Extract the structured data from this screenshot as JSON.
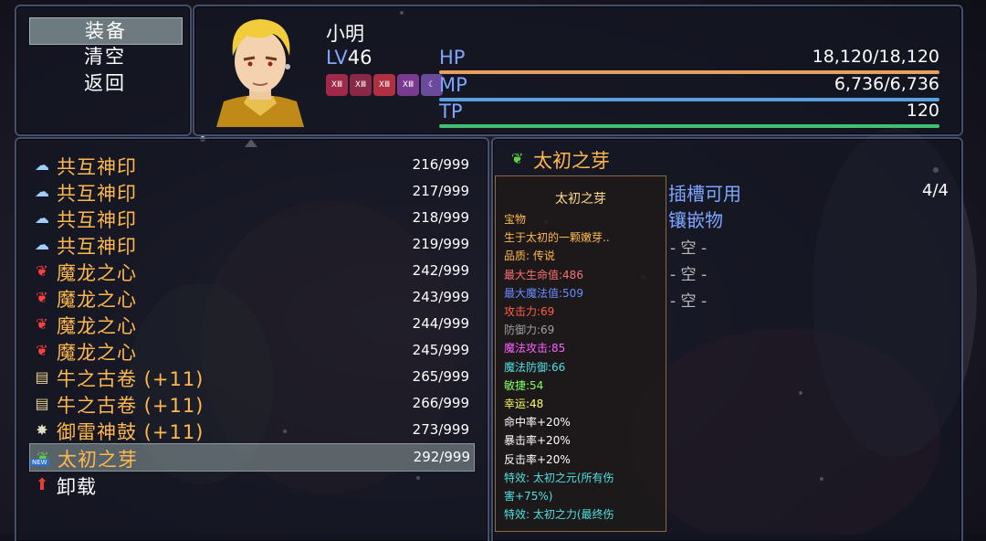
{
  "menu": {
    "commands": [
      {
        "label": "装备"
      },
      {
        "label": "清空"
      },
      {
        "label": "返回"
      }
    ]
  },
  "actor": {
    "name": "小明",
    "level_label": "LV",
    "level": "46",
    "state_icons": [
      "icon-1",
      "icon-2",
      "icon-3",
      "icon-4",
      "icon-5"
    ],
    "stats": [
      {
        "label": "HP",
        "value": "18,120/18,120",
        "fill": 1.0,
        "color": "#e8a060"
      },
      {
        "label": "MP",
        "value": "6,736/6,736",
        "fill": 1.0,
        "color": "#5aa0e0"
      },
      {
        "label": "TP",
        "value": "120",
        "fill": 1.0,
        "color": "#40c070"
      }
    ]
  },
  "items": [
    {
      "icon": "seal-icon",
      "name": "共互神印",
      "count": "216/999"
    },
    {
      "icon": "seal-icon",
      "name": "共互神印",
      "count": "217/999"
    },
    {
      "icon": "seal-icon",
      "name": "共互神印",
      "count": "218/999"
    },
    {
      "icon": "seal-icon",
      "name": "共互神印",
      "count": "219/999"
    },
    {
      "icon": "dragon-heart-icon",
      "name": "魔龙之心",
      "count": "242/999"
    },
    {
      "icon": "dragon-heart-icon",
      "name": "魔龙之心",
      "count": "243/999"
    },
    {
      "icon": "dragon-heart-icon",
      "name": "魔龙之心",
      "count": "244/999"
    },
    {
      "icon": "dragon-heart-icon",
      "name": "魔龙之心",
      "count": "245/999"
    },
    {
      "icon": "scroll-icon",
      "name": "牛之古卷 (+11)",
      "count": "265/999"
    },
    {
      "icon": "scroll-icon",
      "name": "牛之古卷 (+11)",
      "count": "266/999"
    },
    {
      "icon": "drum-icon",
      "name": "御雷神鼓 (+11)",
      "count": "273/999"
    },
    {
      "icon": "sprout-icon",
      "name": "太初之芽",
      "count": "292/999",
      "badge": "NEW",
      "selected": true
    }
  ],
  "unequip": {
    "icon": "arrow-up-icon",
    "label": "卸载"
  },
  "detail": {
    "title": "太初之芽",
    "tooltip": [
      {
        "text": "太初之芽",
        "color": "#ffd98a"
      },
      {
        "text": "宝物",
        "color": "#ffb84d"
      },
      {
        "text": "生于太初的一颗嫩芽..",
        "color": "#ffb84d"
      },
      {
        "text": "品质: 传说",
        "color": "#ffb84d"
      },
      {
        "text": "最大生命值:486",
        "color": "#ff7070"
      },
      {
        "text": "最大魔法值:509",
        "color": "#6a8cff"
      },
      {
        "text": "攻击力:69",
        "color": "#ff6040"
      },
      {
        "text": "防御力:69",
        "color": "#a0a0a0"
      },
      {
        "text": "魔法攻击:85",
        "color": "#ff60ff"
      },
      {
        "text": "魔法防御:66",
        "color": "#50e0e0"
      },
      {
        "text": "敏捷:54",
        "color": "#80ff60"
      },
      {
        "text": "幸运:48",
        "color": "#ffff60"
      },
      {
        "text": "命中率+20%",
        "color": "#ffffff"
      },
      {
        "text": "暴击率+20%",
        "color": "#ffffff"
      },
      {
        "text": "反击率+20%",
        "color": "#ffffff"
      },
      {
        "text": "特效: 太初之元(所有伤",
        "color": "#50e0e0"
      },
      {
        "text": "害+75%)",
        "color": "#50e0e0"
      },
      {
        "text": "特效: 太初之力(最终伤",
        "color": "#50e0e0"
      }
    ],
    "slots_label": "插槽可用",
    "slots_value": "4/4",
    "inlay_label": "镶嵌物",
    "slots": [
      "- 空 -",
      "- 空 -",
      "- 空 -"
    ]
  }
}
